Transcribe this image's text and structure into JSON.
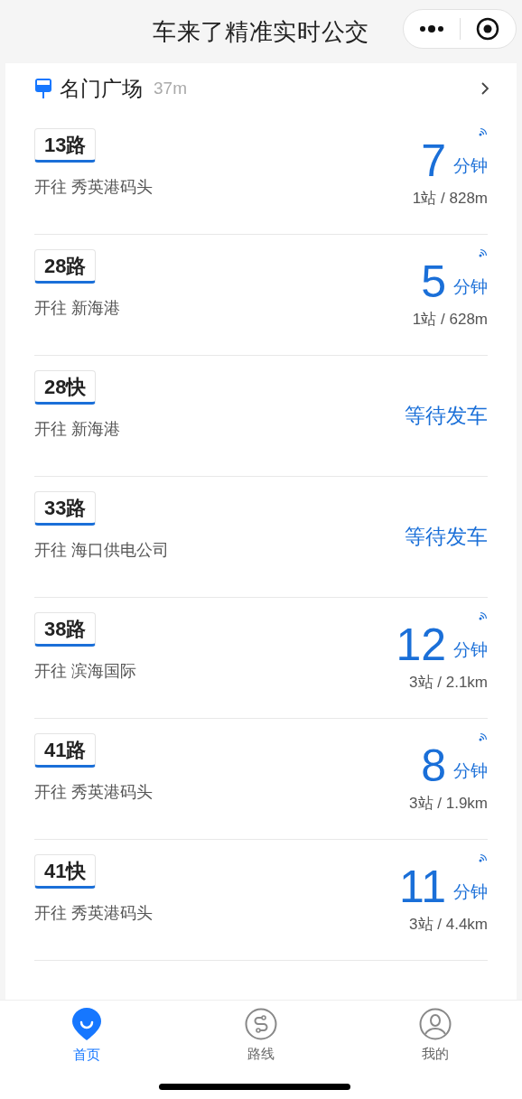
{
  "title": "车来了精准实时公交",
  "station": {
    "name": "名门广场",
    "distance": "37m"
  },
  "routes": [
    {
      "kind": "eta",
      "route": "13路",
      "destination": "开往 秀英港码头",
      "minutes": "7",
      "unit": "分钟",
      "stops": "1站 / 828m"
    },
    {
      "kind": "eta",
      "route": "28路",
      "destination": "开往 新海港",
      "minutes": "5",
      "unit": "分钟",
      "stops": "1站 / 628m"
    },
    {
      "kind": "waiting",
      "route": "28快",
      "destination": "开往 新海港",
      "status": "等待发车"
    },
    {
      "kind": "waiting",
      "route": "33路",
      "destination": "开往 海口供电公司",
      "status": "等待发车"
    },
    {
      "kind": "eta",
      "route": "38路",
      "destination": "开往 滨海国际",
      "minutes": "12",
      "unit": "分钟",
      "stops": "3站 / 2.1km"
    },
    {
      "kind": "eta",
      "route": "41路",
      "destination": "开往 秀英港码头",
      "minutes": "8",
      "unit": "分钟",
      "stops": "3站 / 1.9km"
    },
    {
      "kind": "eta",
      "route": "41快",
      "destination": "开往 秀英港码头",
      "minutes": "11",
      "unit": "分钟",
      "stops": "3站 / 4.4km"
    }
  ],
  "tabs": [
    {
      "label": "首页",
      "kind": "home",
      "selected": true
    },
    {
      "label": "路线",
      "kind": "route",
      "selected": false
    },
    {
      "label": "我的",
      "kind": "user",
      "selected": false
    }
  ]
}
